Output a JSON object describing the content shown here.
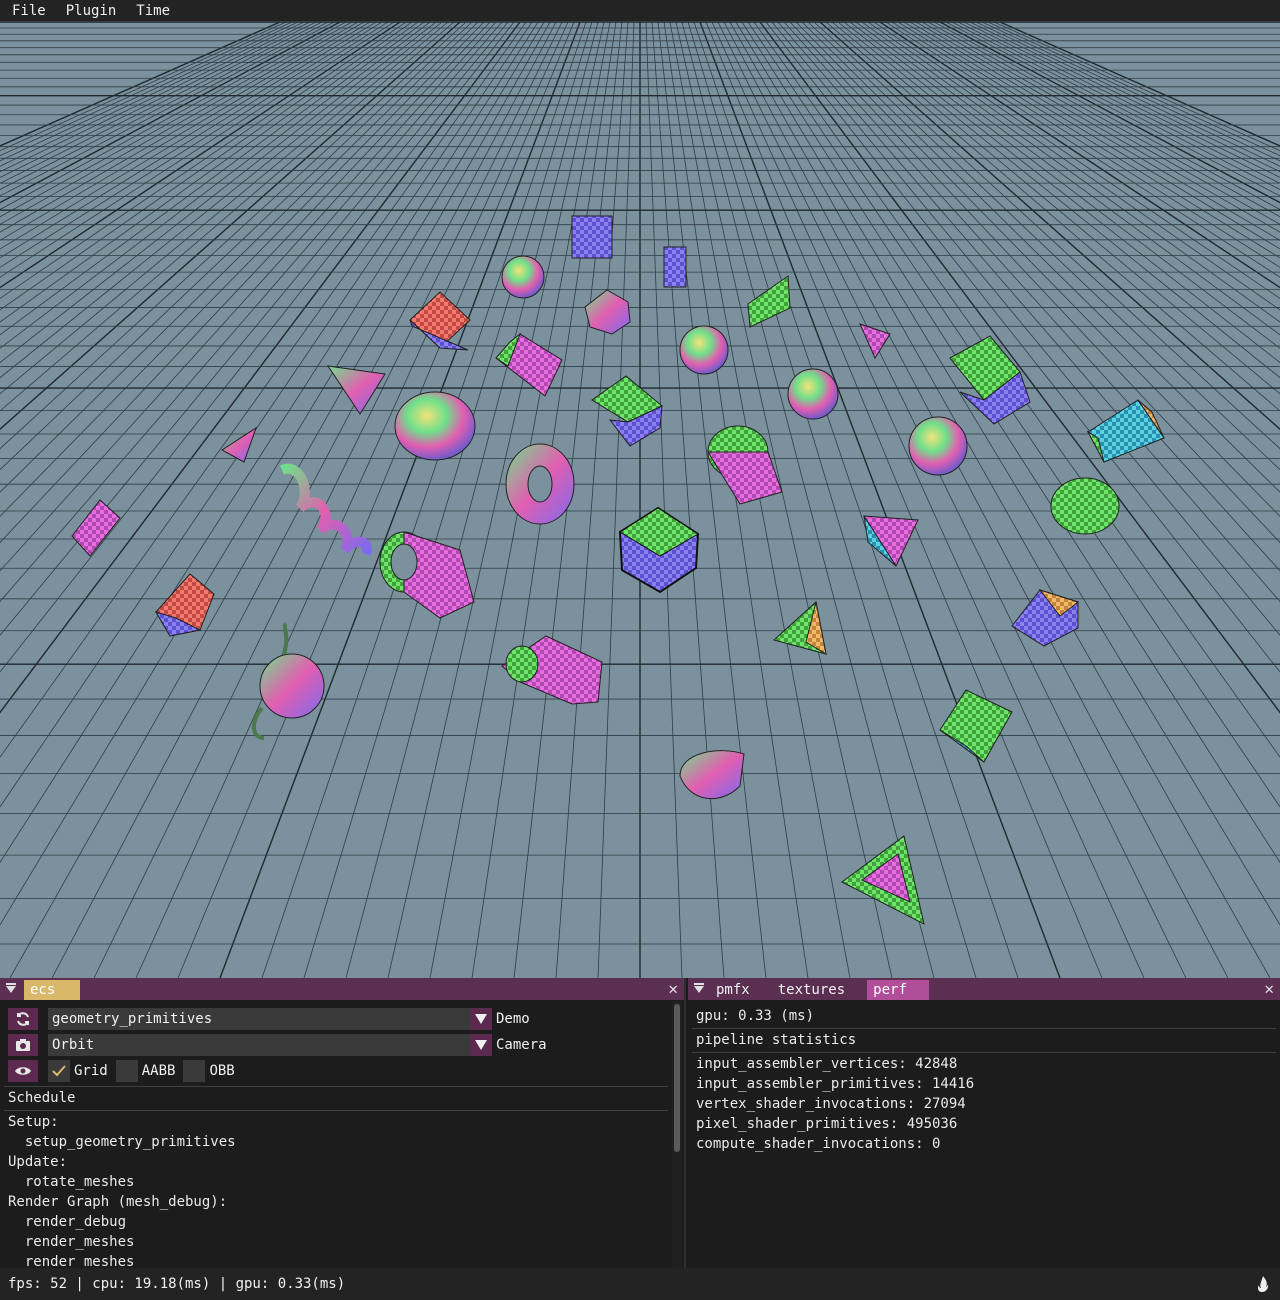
{
  "menubar": {
    "items": [
      "File",
      "Plugin",
      "Time"
    ]
  },
  "viewport": {
    "background": "#7b919d",
    "grid_color": "#2f3e45",
    "objects": [
      "checker-cube",
      "checker-box",
      "icosphere",
      "dodecahedron",
      "wedge",
      "cone",
      "pyramid",
      "prism",
      "helix",
      "cylinder",
      "torus",
      "rounded-cube",
      "capsule",
      "sphere",
      "tube",
      "teapot",
      "triangle-frame",
      "octahedron",
      "tetrahedron",
      "disc"
    ]
  },
  "ecs_panel": {
    "tab_label": "ecs",
    "scene_combo": {
      "value": "geometry_primitives",
      "label": "Demo"
    },
    "camera_combo": {
      "value": "Orbit",
      "label": "Camera"
    },
    "toggles": [
      {
        "label": "Grid",
        "checked": true
      },
      {
        "label": "AABB",
        "checked": false
      },
      {
        "label": "OBB",
        "checked": false
      }
    ],
    "schedule_header": "Schedule",
    "schedule_lines": [
      "Setup:",
      "  setup_geometry_primitives",
      "Update:",
      "  rotate_meshes",
      "Render Graph (mesh_debug):",
      "  render_debug",
      "  render_meshes",
      "  render_meshes"
    ]
  },
  "perf_panel": {
    "tabs": [
      "pmfx",
      "textures",
      "perf"
    ],
    "active_tab": "perf",
    "gpu_line": "gpu: 0.33 (ms)",
    "stats_header": "pipeline statistics",
    "stats": [
      "input_assembler_vertices: 42848",
      "input_assembler_primitives: 14416",
      "vertex_shader_invocations: 27094",
      "pixel_shader_primitives: 495036",
      "compute_shader_invocations: 0"
    ]
  },
  "statusbar": {
    "text": "fps: 52 | cpu: 19.18(ms) | gpu: 0.33(ms)"
  },
  "colors": {
    "accent_tab": "#b04e9a",
    "ecs_tab": "#d9b86a",
    "tabbar": "#5a2f52",
    "button": "#5d2a4f"
  }
}
